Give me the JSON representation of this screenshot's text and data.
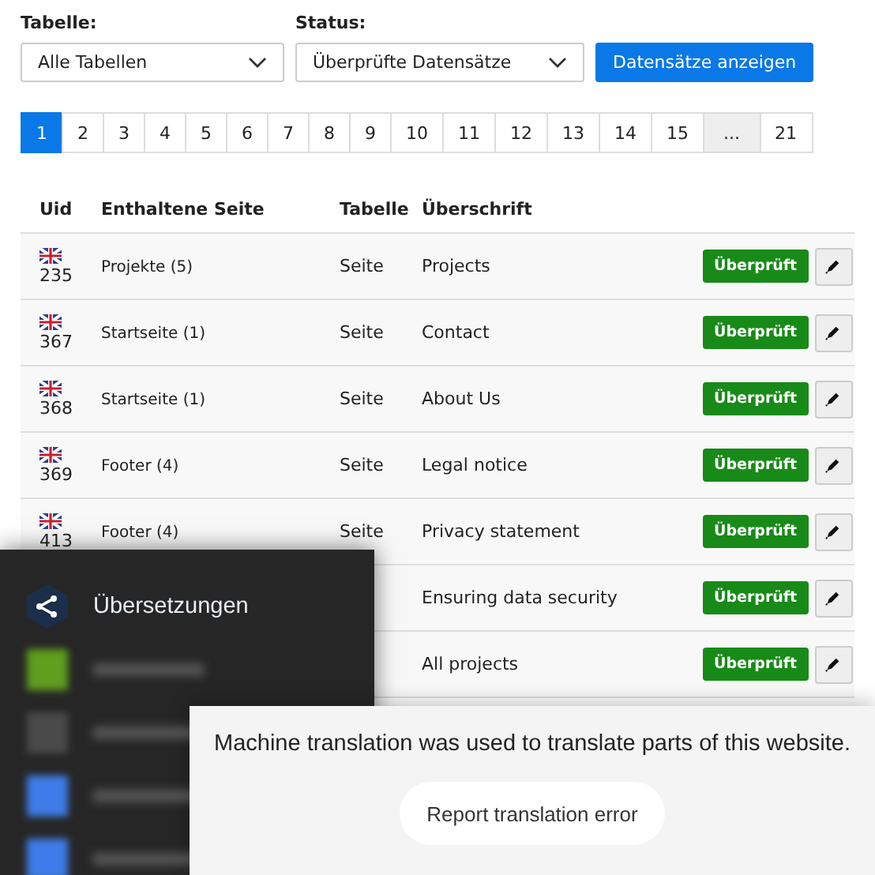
{
  "filters": [
    {
      "label": "Tabelle:",
      "value": "Alle Tabellen"
    },
    {
      "label": "Status:",
      "value": "Überprüfte Datensätze"
    }
  ],
  "show_button": "Datensätze anzeigen",
  "pagination": [
    {
      "label": "1",
      "kind": "page",
      "selected": true
    },
    {
      "label": "2",
      "kind": "page",
      "selected": false
    },
    {
      "label": "3",
      "kind": "page",
      "selected": false
    },
    {
      "label": "4",
      "kind": "page",
      "selected": false
    },
    {
      "label": "5",
      "kind": "page",
      "selected": false
    },
    {
      "label": "6",
      "kind": "page",
      "selected": false
    },
    {
      "label": "7",
      "kind": "page",
      "selected": false
    },
    {
      "label": "8",
      "kind": "page",
      "selected": false
    },
    {
      "label": "9",
      "kind": "page",
      "selected": false
    },
    {
      "label": "10",
      "kind": "page",
      "selected": false
    },
    {
      "label": "11",
      "kind": "page",
      "selected": false
    },
    {
      "label": "12",
      "kind": "page",
      "selected": false
    },
    {
      "label": "13",
      "kind": "page",
      "selected": false
    },
    {
      "label": "14",
      "kind": "page",
      "selected": false
    },
    {
      "label": "15",
      "kind": "page",
      "selected": false
    },
    {
      "label": "...",
      "kind": "ellipsis",
      "selected": false
    },
    {
      "label": "21",
      "kind": "page",
      "selected": false
    }
  ],
  "table": {
    "columns": [
      "Uid",
      "Enthaltene Seite",
      "Tabelle",
      "Überschrift"
    ],
    "rows": [
      {
        "uid": "235",
        "page": "Projekte (5)",
        "table": "Seite",
        "heading": "Projects",
        "status": "Überprüft"
      },
      {
        "uid": "367",
        "page": "Startseite (1)",
        "table": "Seite",
        "heading": "Contact",
        "status": "Überprüft"
      },
      {
        "uid": "368",
        "page": "Startseite (1)",
        "table": "Seite",
        "heading": "About Us",
        "status": "Überprüft"
      },
      {
        "uid": "369",
        "page": "Footer (4)",
        "table": "Seite",
        "heading": "Legal notice",
        "status": "Überprüft"
      },
      {
        "uid": "413",
        "page": "Footer (4)",
        "table": "Seite",
        "heading": "Privacy statement",
        "status": "Überprüft"
      },
      {
        "heading": "Ensuring data security",
        "status": "Überprüft"
      },
      {
        "heading": "All projects",
        "status": "Überprüft"
      }
    ]
  },
  "side_menu": {
    "items": [
      {
        "kind": "active",
        "label": "Übersetzungen"
      },
      {
        "kind": "blurred",
        "color": "#5f9e1f"
      },
      {
        "kind": "blurred",
        "color": "#4a4a4a"
      },
      {
        "kind": "blurred",
        "color": "#3f7ce8"
      },
      {
        "kind": "blurred",
        "color": "#3f7ce8"
      }
    ]
  },
  "translation_notice": {
    "message": "Machine translation was used to translate parts of this website.",
    "button": "Report translation error"
  }
}
